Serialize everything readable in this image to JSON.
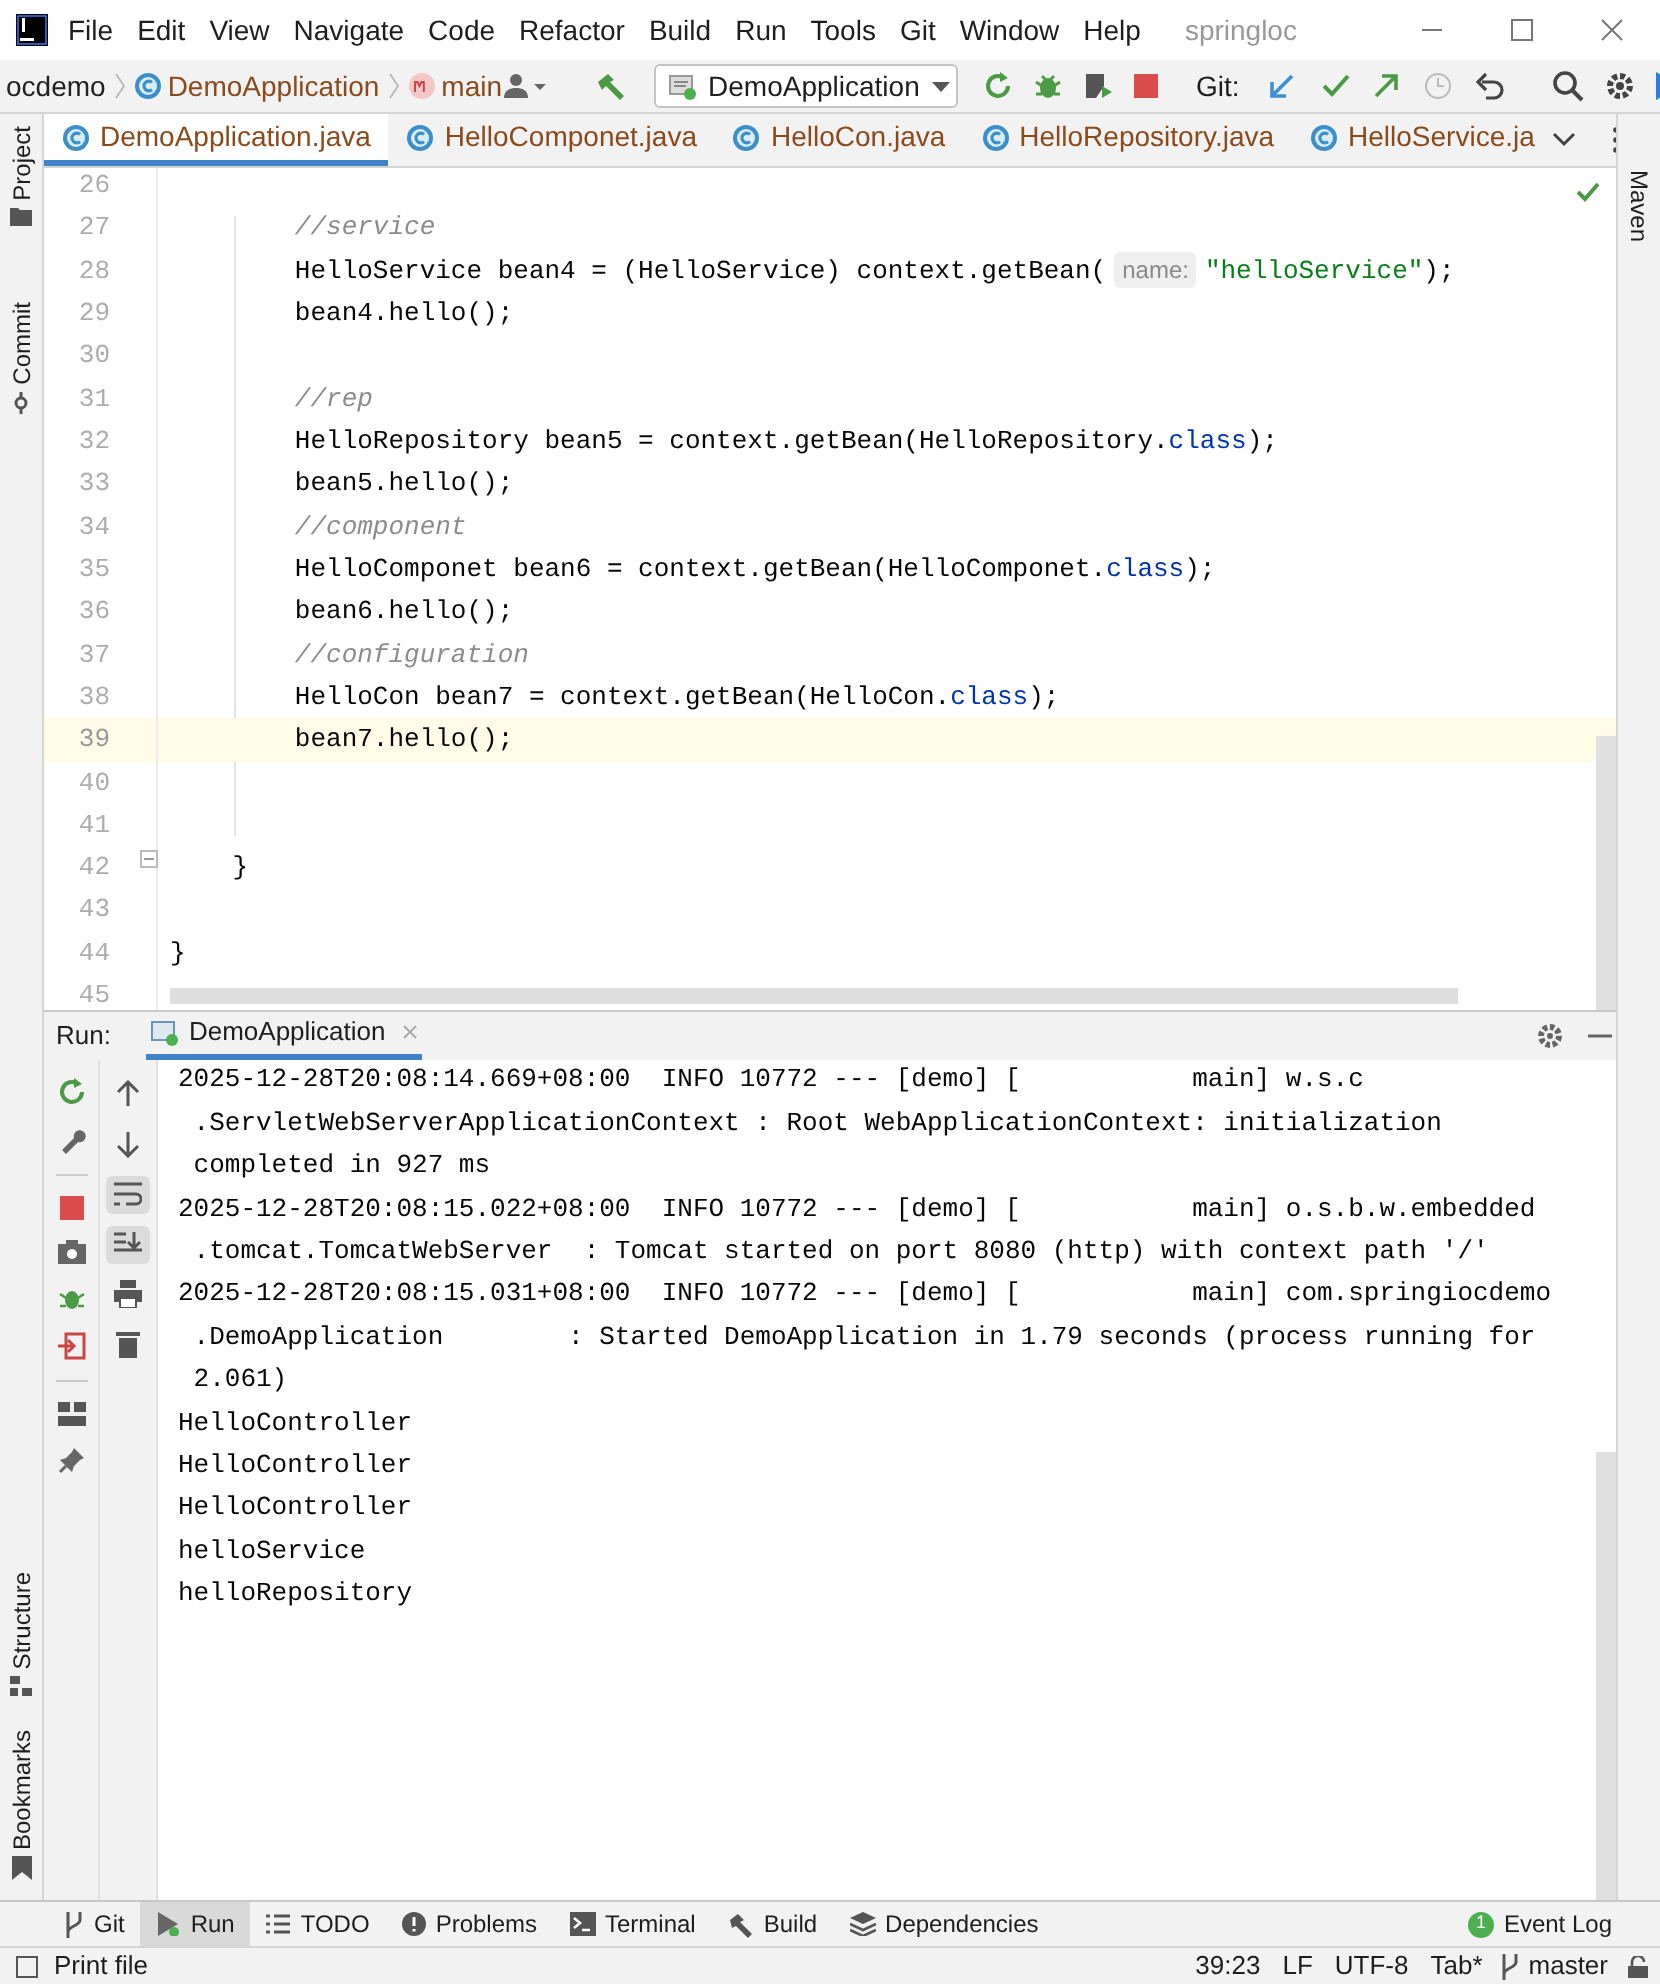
{
  "window": {
    "title": "springloc",
    "menu": [
      "File",
      "Edit",
      "View",
      "Navigate",
      "Code",
      "Refactor",
      "Build",
      "Run",
      "Tools",
      "Git",
      "Window",
      "Help"
    ]
  },
  "navbar": {
    "breadcrumbs": [
      {
        "label": "ocdemo",
        "kind": "folder"
      },
      {
        "label": "DemoApplication",
        "kind": "class"
      },
      {
        "label": "main",
        "kind": "method"
      }
    ],
    "run_config": "DemoApplication",
    "git_label": "Git:"
  },
  "editor_tabs": [
    {
      "label": "DemoApplication.java",
      "selected": true
    },
    {
      "label": "HelloComponet.java",
      "selected": false
    },
    {
      "label": "HelloCon.java",
      "selected": false
    },
    {
      "label": "HelloRepository.java",
      "selected": false
    },
    {
      "label": "HelloService.ja",
      "selected": false
    }
  ],
  "left_stripe": {
    "top": [
      "Project",
      "Commit"
    ],
    "bottom": [
      "Structure",
      "Bookmarks"
    ]
  },
  "right_stripe": [
    "Maven"
  ],
  "editor": {
    "lines": [
      {
        "number": "26",
        "current": false
      },
      {
        "number": "27",
        "current": false,
        "segments": [
          {
            "kind": "comment",
            "text": "        //service"
          }
        ]
      },
      {
        "number": "28",
        "current": false,
        "segments": [
          {
            "kind": "plain",
            "text": "        HelloService bean4 = (HelloService) context.getBean("
          },
          {
            "kind": "hint",
            "text": "name:"
          },
          {
            "kind": "string",
            "text": "\"helloService\""
          },
          {
            "kind": "plain",
            "text": ");"
          }
        ]
      },
      {
        "number": "29",
        "current": false,
        "segments": [
          {
            "kind": "plain",
            "text": "        bean4.hello();"
          }
        ]
      },
      {
        "number": "30",
        "current": false
      },
      {
        "number": "31",
        "current": false,
        "segments": [
          {
            "kind": "comment",
            "text": "        //rep"
          }
        ]
      },
      {
        "number": "32",
        "current": false,
        "segments": [
          {
            "kind": "plain",
            "text": "        HelloRepository bean5 = context.getBean(HelloRepository."
          },
          {
            "kind": "keyword",
            "text": "class"
          },
          {
            "kind": "plain",
            "text": ");"
          }
        ]
      },
      {
        "number": "33",
        "current": false,
        "segments": [
          {
            "kind": "plain",
            "text": "        bean5.hello();"
          }
        ]
      },
      {
        "number": "34",
        "current": false,
        "segments": [
          {
            "kind": "comment",
            "text": "        //component"
          }
        ]
      },
      {
        "number": "35",
        "current": false,
        "segments": [
          {
            "kind": "plain",
            "text": "        HelloComponet bean6 = context.getBean(HelloComponet."
          },
          {
            "kind": "keyword",
            "text": "class"
          },
          {
            "kind": "plain",
            "text": ");"
          }
        ]
      },
      {
        "number": "36",
        "current": false,
        "segments": [
          {
            "kind": "plain",
            "text": "        bean6.hello();"
          }
        ]
      },
      {
        "number": "37",
        "current": false,
        "segments": [
          {
            "kind": "comment",
            "text": "        //configuration"
          }
        ]
      },
      {
        "number": "38",
        "current": false,
        "segments": [
          {
            "kind": "plain",
            "text": "        HelloCon bean7 = context.getBean(HelloCon."
          },
          {
            "kind": "keyword",
            "text": "class"
          },
          {
            "kind": "plain",
            "text": ");"
          }
        ]
      },
      {
        "number": "39",
        "current": true,
        "segments": [
          {
            "kind": "plain",
            "text": "        bean7.hello();"
          }
        ]
      },
      {
        "number": "40",
        "current": false
      },
      {
        "number": "41",
        "current": false
      },
      {
        "number": "42",
        "current": false,
        "segments": [
          {
            "kind": "plain",
            "text": "    }"
          }
        ]
      },
      {
        "number": "43",
        "current": false
      },
      {
        "number": "44",
        "current": false,
        "segments": [
          {
            "kind": "plain",
            "text": "}"
          }
        ]
      },
      {
        "number": "45",
        "current": false
      }
    ]
  },
  "run_panel": {
    "label": "Run:",
    "tab": "DemoApplication",
    "console": [
      "2025-12-28T20:08:14.669+08:00  INFO 10772 --- [demo] [           main] w.s.c",
      " .ServletWebServerApplicationContext : Root WebApplicationContext: initialization",
      " completed in 927 ms",
      "2025-12-28T20:08:15.022+08:00  INFO 10772 --- [demo] [           main] o.s.b.w.embedded",
      " .tomcat.TomcatWebServer  : Tomcat started on port 8080 (http) with context path '/'",
      "2025-12-28T20:08:15.031+08:00  INFO 10772 --- [demo] [           main] com.springiocdemo",
      " .DemoApplication        : Started DemoApplication in 1.79 seconds (process running for",
      " 2.061)",
      "HelloController",
      "HelloController",
      "HelloController",
      "helloService",
      "helloRepository"
    ]
  },
  "tool_windows": [
    {
      "label": "Git",
      "kind": "git",
      "selected": false
    },
    {
      "label": "Run",
      "kind": "run",
      "selected": true
    },
    {
      "label": "TODO",
      "kind": "todo",
      "selected": false
    },
    {
      "label": "Problems",
      "kind": "problems",
      "selected": false
    },
    {
      "label": "Terminal",
      "kind": "terminal",
      "selected": false
    },
    {
      "label": "Build",
      "kind": "build",
      "selected": false
    },
    {
      "label": "Dependencies",
      "kind": "dependencies",
      "selected": false
    }
  ],
  "event_log": {
    "label": "Event Log",
    "badge": "1"
  },
  "status_bar": {
    "message": "Print file",
    "position": "39:23",
    "line_ending": "LF",
    "encoding": "UTF-8",
    "indent": "Tab*",
    "branch": "master"
  }
}
